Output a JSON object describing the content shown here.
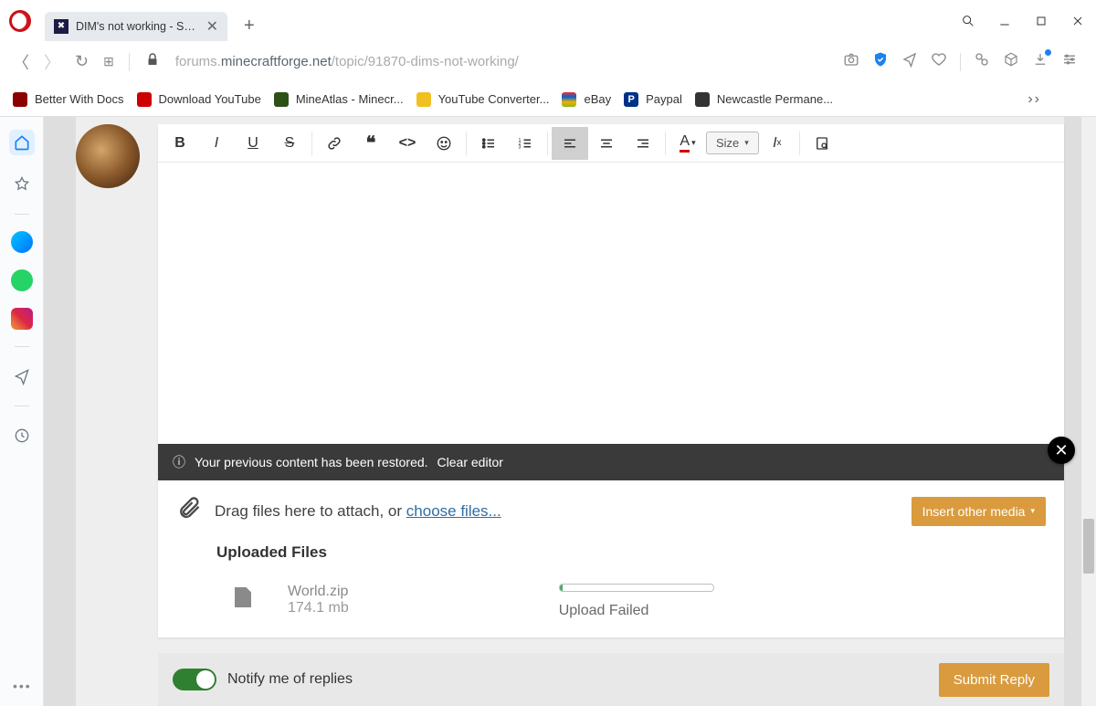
{
  "tab": {
    "title": "DIM's not working - Suppo"
  },
  "url": {
    "prefix": "forums.",
    "domain": "minecraftforge.net",
    "path": "/topic/91870-dims-not-working/"
  },
  "bookmarks": [
    {
      "label": "Better With Docs",
      "color": "#8b0000"
    },
    {
      "label": "Download YouTube",
      "color": "#cc0000"
    },
    {
      "label": "MineAtlas - Minecr...",
      "color": "#2d5016"
    },
    {
      "label": "YouTube Converter...",
      "color": "#f0c020"
    },
    {
      "label": "eBay",
      "color": "#e53238"
    },
    {
      "label": "Paypal",
      "color": "#003087"
    },
    {
      "label": "Newcastle Permane...",
      "color": "#333"
    }
  ],
  "toolbar": {
    "size_label": "Size"
  },
  "restore": {
    "message": "Your previous content has been restored.",
    "clear": "Clear editor"
  },
  "attach": {
    "text": "Drag files here to attach, or ",
    "link": "choose files...",
    "insert": "Insert other media"
  },
  "uploaded": {
    "heading": "Uploaded Files",
    "file_name": "World.zip",
    "file_size": "174.1 mb",
    "status": "Upload Failed"
  },
  "bottom": {
    "notify": "Notify me of replies",
    "submit": "Submit Reply"
  }
}
